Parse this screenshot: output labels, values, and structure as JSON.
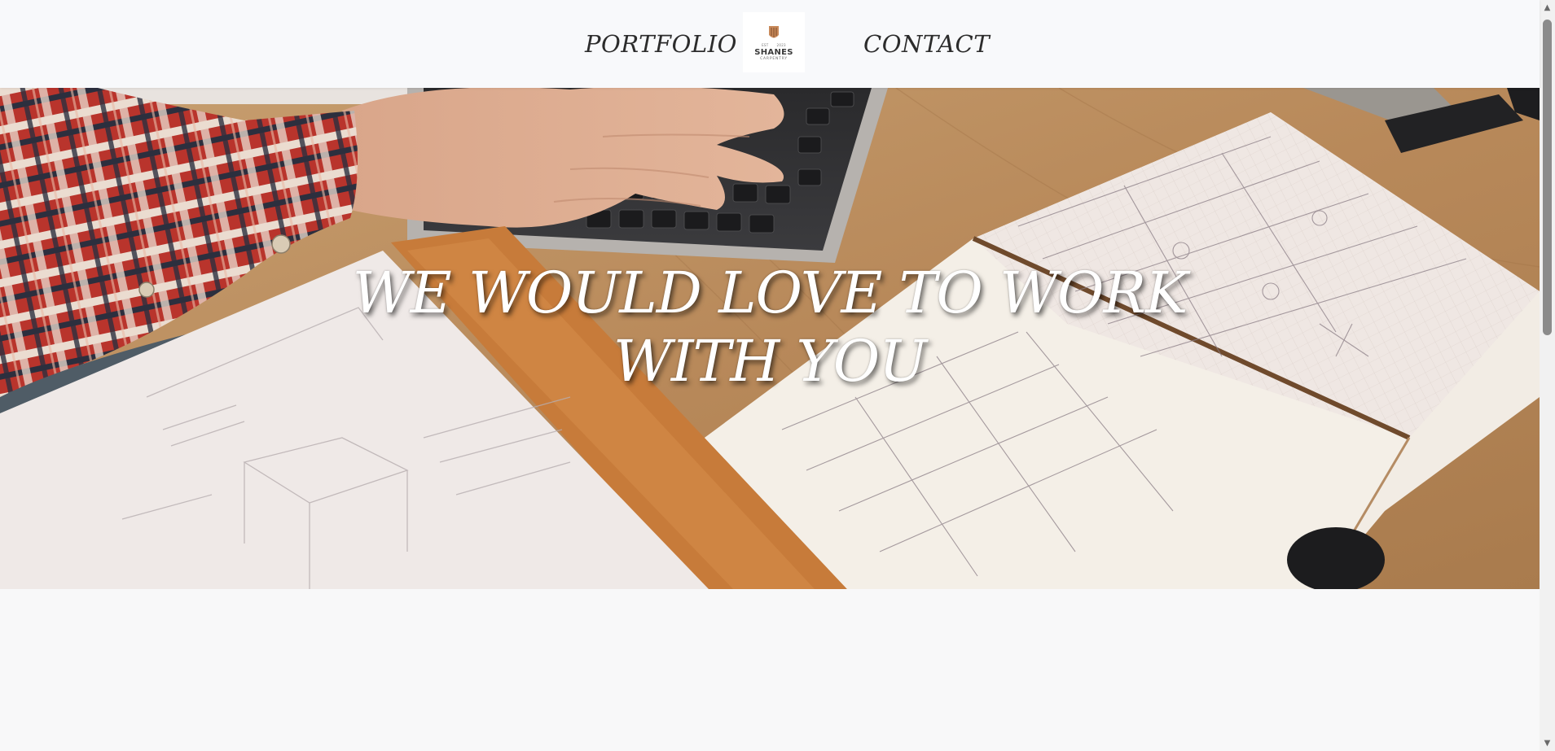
{
  "nav": {
    "portfolio_label": "PORTFOLIO",
    "contact_label": "CONTACT"
  },
  "logo": {
    "name": "SHANES",
    "subtitle": "CARPENTRY",
    "est_left": "EST",
    "est_right": "2023"
  },
  "hero": {
    "title_line1": "WE WOULD LOVE TO WORK",
    "title_line2": "WITH YOU"
  },
  "scrollbar": {
    "up_icon": "triangle-up",
    "down_icon": "triangle-down"
  },
  "colors": {
    "header_bg": "#f8f9fb",
    "nav_text": "#2c2c2c",
    "hero_text": "#ffffff",
    "page_bg": "#f8f8f9"
  }
}
